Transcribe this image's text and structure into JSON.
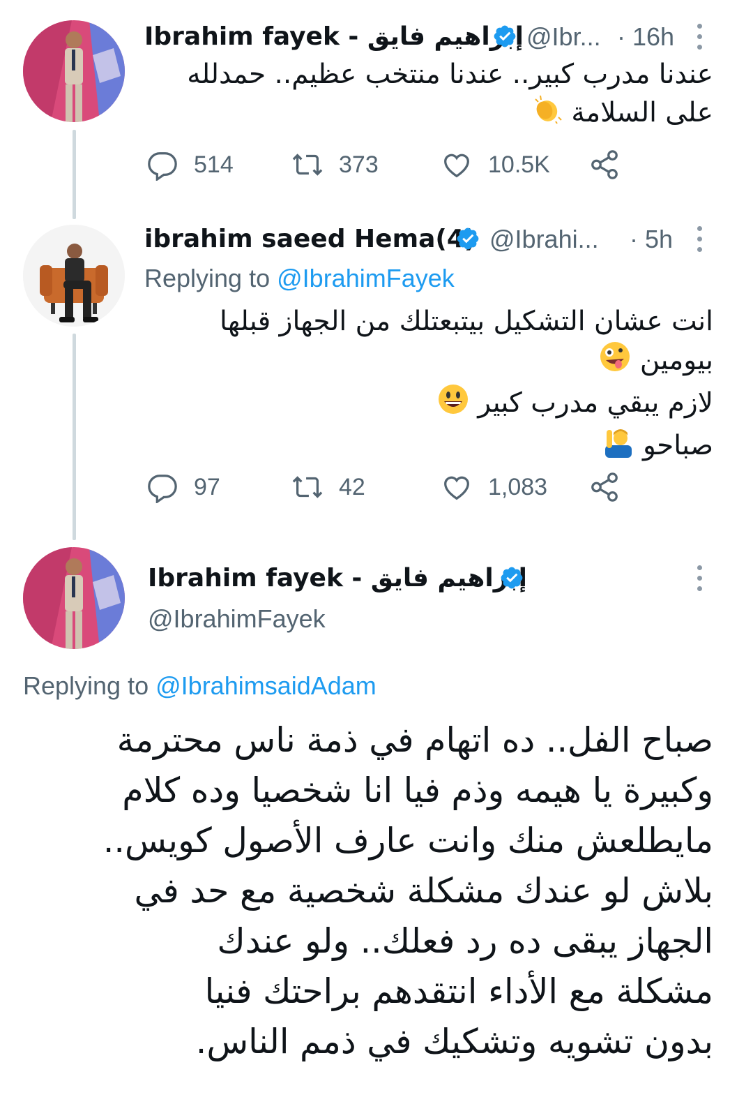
{
  "tweets": [
    {
      "name": "Ibrahim fayek - إبراهيم فايق",
      "handle": "@Ibr...",
      "time": "· 16h",
      "lines": [
        "عندنا مدرب كبير.. عندنا منتخب عظيم.. حمدلله",
        "على السلامة"
      ],
      "emoji": [
        "clapping-hands"
      ],
      "replies": "514",
      "retweets": "373",
      "likes": "10.5K"
    },
    {
      "name": "ibrahim saeed Hema(4)",
      "handle": "@Ibrahi...",
      "time": "· 5h",
      "replying_label": "Replying to",
      "replying_to": "@IbrahimFayek",
      "lines": [
        "انت عشان التشكيل بيتبعتلك من الجهاز قبلها",
        "بيومين",
        "لازم يبقي مدرب كبير",
        "صباحو"
      ],
      "emoji": [
        "zany-face",
        "grinning-face",
        "person-raising-hand"
      ],
      "replies": "97",
      "retweets": "42",
      "likes": "1,083"
    }
  ],
  "main_tweet": {
    "name": "Ibrahim fayek - إبراهيم فايق",
    "handle": "@IbrahimFayek",
    "replying_label": "Replying to",
    "replying_to": "@IbrahimsaidAdam",
    "lines": [
      "صباح الفل.. ده اتهام في ذمة ناس محترمة",
      "وكبيرة يا هيمه وذم فيا انا شخصيا وده كلام",
      "مايطلعش منك وانت عارف الأصول كويس..",
      "بلاش لو عندك مشكلة شخصية مع حد في",
      "الجهاز يبقى ده رد فعلك.. ولو عندك",
      "مشكلة مع الأداء انتقدهم براحتك فنيا",
      "بدون تشويه وتشكيك في ذمم الناس."
    ]
  },
  "colors": {
    "accent": "#1d9bf0",
    "secondary_text": "#536471",
    "thread_line": "#cfd9de"
  },
  "icons": [
    "reply-icon",
    "retweet-icon",
    "like-icon",
    "share-icon",
    "verified-badge-icon",
    "more-icon"
  ]
}
